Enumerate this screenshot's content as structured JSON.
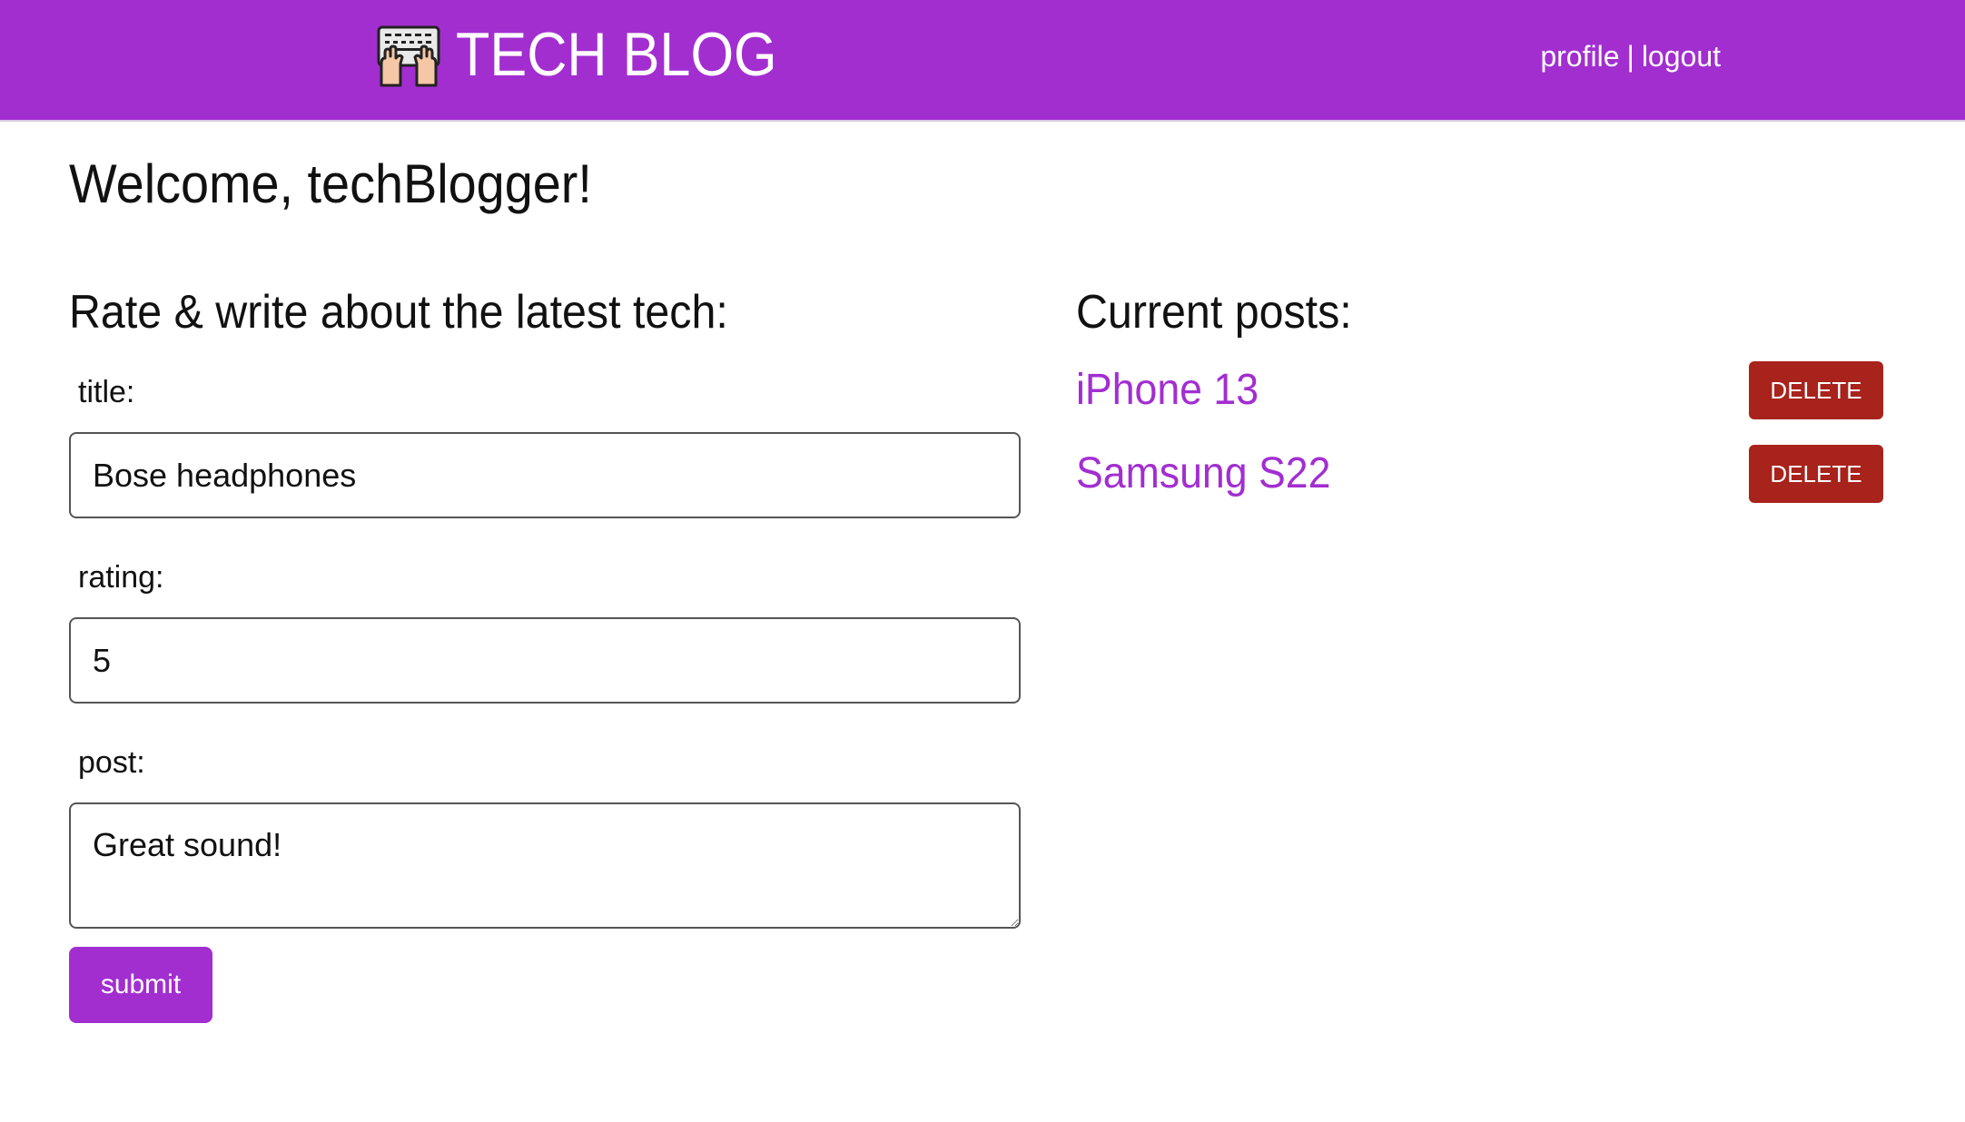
{
  "header": {
    "brand_icon": "keyboard-typing-hands-icon",
    "title": "TECH BLOG",
    "nav": {
      "profile_label": "profile",
      "separator": "|",
      "logout_label": "logout"
    },
    "colors": {
      "background": "#a22ed0",
      "text": "#ffffff"
    }
  },
  "welcome": "Welcome, techBlogger!",
  "form": {
    "heading": "Rate & write about the latest tech:",
    "title_label": "title:",
    "title_value": "Bose headphones",
    "rating_label": "rating:",
    "rating_value": "5",
    "post_label": "post:",
    "post_value": "Great sound!",
    "submit_label": "submit"
  },
  "posts": {
    "heading": "Current posts:",
    "items": [
      {
        "title": "iPhone 13",
        "delete_label": "DELETE"
      },
      {
        "title": "Samsung S22",
        "delete_label": "DELETE"
      }
    ],
    "colors": {
      "link": "#a22ed0",
      "delete": "#a8231c"
    }
  }
}
